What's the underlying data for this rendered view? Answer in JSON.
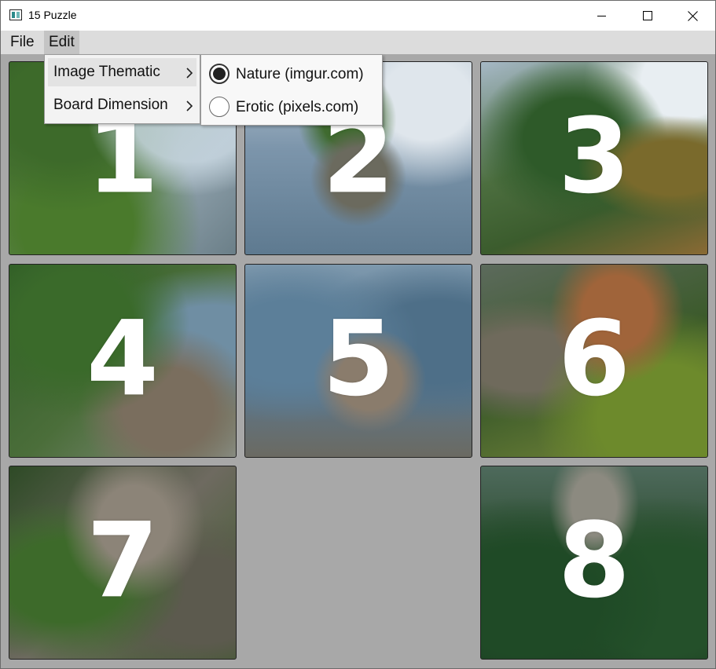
{
  "window": {
    "title": "15 Puzzle",
    "icon": "puzzle-app-icon"
  },
  "menubar": {
    "file_label": "File",
    "edit_label": "Edit"
  },
  "edit_menu": {
    "items": [
      {
        "label": "Image Thematic",
        "highlighted": true,
        "has_submenu": true
      },
      {
        "label": "Board Dimension",
        "highlighted": false,
        "has_submenu": true
      }
    ]
  },
  "image_thematic_submenu": {
    "options": [
      {
        "label": "Nature (imgur.com)",
        "selected": true
      },
      {
        "label": "Erotic (pixels.com)",
        "selected": false
      }
    ]
  },
  "board": {
    "rows": 3,
    "cols": 3,
    "tiles": [
      {
        "number": "1",
        "cell": [
          1,
          1
        ]
      },
      {
        "number": "2",
        "cell": [
          1,
          2
        ]
      },
      {
        "number": "3",
        "cell": [
          1,
          3
        ]
      },
      {
        "number": "4",
        "cell": [
          2,
          1
        ]
      },
      {
        "number": "5",
        "cell": [
          2,
          2
        ]
      },
      {
        "number": "6",
        "cell": [
          2,
          3
        ]
      },
      {
        "number": "7",
        "cell": [
          3,
          1
        ]
      },
      {
        "number": "8",
        "cell": [
          3,
          3
        ]
      }
    ],
    "empty_cell": [
      3,
      2
    ],
    "background_color": "#a8a8a8"
  }
}
